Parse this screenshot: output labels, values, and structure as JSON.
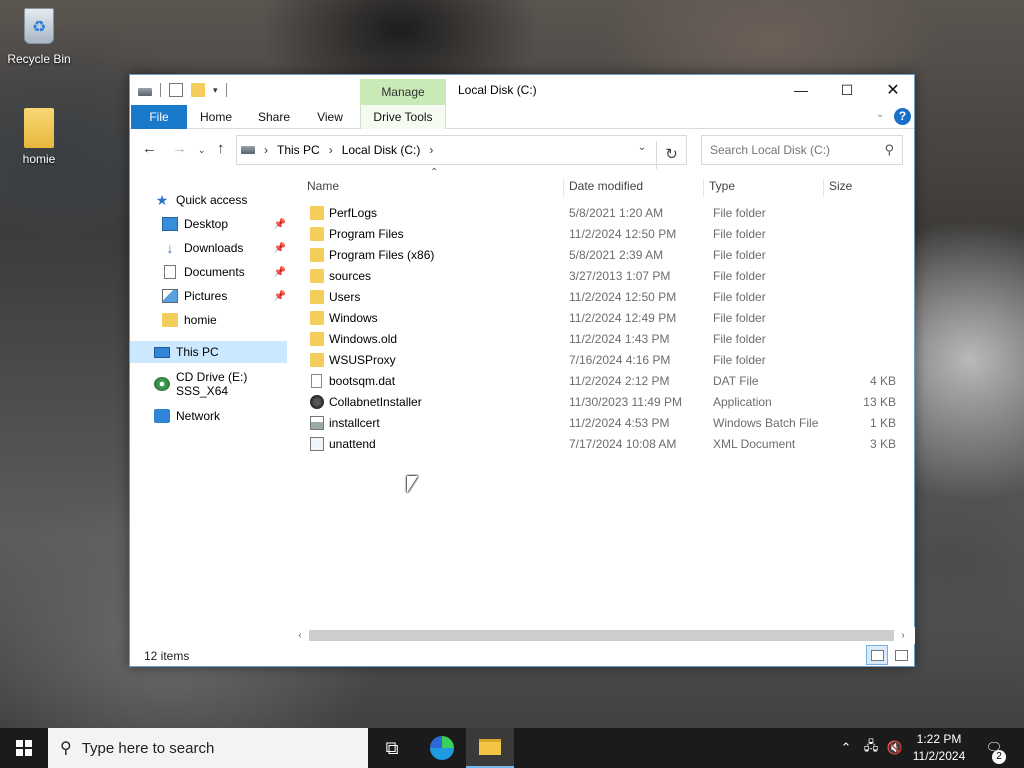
{
  "desktop": {
    "icons": [
      {
        "label": "Recycle Bin",
        "icon": "recycle-bin-icon"
      },
      {
        "label": "homie",
        "icon": "folder-icon"
      }
    ]
  },
  "window": {
    "title": "Local Disk (C:)",
    "context_tab": "Manage",
    "ribbon_tabs": [
      "File",
      "Home",
      "Share",
      "View",
      "Drive Tools"
    ],
    "address": {
      "crumbs": [
        "This PC",
        "Local Disk (C:)"
      ]
    },
    "search": {
      "placeholder": "Search Local Disk (C:)"
    },
    "nav_pane": {
      "quick_access": "Quick access",
      "quick_items": [
        "Desktop",
        "Downloads",
        "Documents",
        "Pictures",
        "homie"
      ],
      "this_pc": "This PC",
      "cd_drive": "CD Drive (E:) SSS_X64",
      "network": "Network"
    },
    "columns": {
      "name": "Name",
      "date": "Date modified",
      "type": "Type",
      "size": "Size"
    },
    "files": [
      {
        "name": "PerfLogs",
        "date": "5/8/2021 1:20 AM",
        "type": "File folder",
        "size": "",
        "icon": "folder-icon"
      },
      {
        "name": "Program Files",
        "date": "11/2/2024 12:50 PM",
        "type": "File folder",
        "size": "",
        "icon": "folder-icon"
      },
      {
        "name": "Program Files (x86)",
        "date": "5/8/2021 2:39 AM",
        "type": "File folder",
        "size": "",
        "icon": "folder-icon"
      },
      {
        "name": "sources",
        "date": "3/27/2013 1:07 PM",
        "type": "File folder",
        "size": "",
        "icon": "folder-icon"
      },
      {
        "name": "Users",
        "date": "11/2/2024 12:50 PM",
        "type": "File folder",
        "size": "",
        "icon": "folder-icon"
      },
      {
        "name": "Windows",
        "date": "11/2/2024 12:49 PM",
        "type": "File folder",
        "size": "",
        "icon": "folder-icon"
      },
      {
        "name": "Windows.old",
        "date": "11/2/2024 1:43 PM",
        "type": "File folder",
        "size": "",
        "icon": "folder-icon"
      },
      {
        "name": "WSUSProxy",
        "date": "7/16/2024 4:16 PM",
        "type": "File folder",
        "size": "",
        "icon": "folder-icon"
      },
      {
        "name": "bootsqm.dat",
        "date": "11/2/2024 2:12 PM",
        "type": "DAT File",
        "size": "4 KB",
        "icon": "file-icon"
      },
      {
        "name": "CollabnetInstaller",
        "date": "11/30/2023 11:49 PM",
        "type": "Application",
        "size": "13 KB",
        "icon": "application-icon"
      },
      {
        "name": "installcert",
        "date": "11/2/2024 4:53 PM",
        "type": "Windows Batch File",
        "size": "1 KB",
        "icon": "batch-file-icon"
      },
      {
        "name": "unattend",
        "date": "7/17/2024 10:08 AM",
        "type": "XML Document",
        "size": "3 KB",
        "icon": "xml-document-icon"
      }
    ],
    "status": "12 items"
  },
  "taskbar": {
    "search_placeholder": "Type here to search",
    "time": "1:22 PM",
    "date": "11/2/2024",
    "notification_count": "2"
  },
  "colors": {
    "accent": "#1979ca",
    "manage_tab": "#c9eab6",
    "selected": "#cce8ff",
    "taskbar": "#1b1b1b"
  }
}
